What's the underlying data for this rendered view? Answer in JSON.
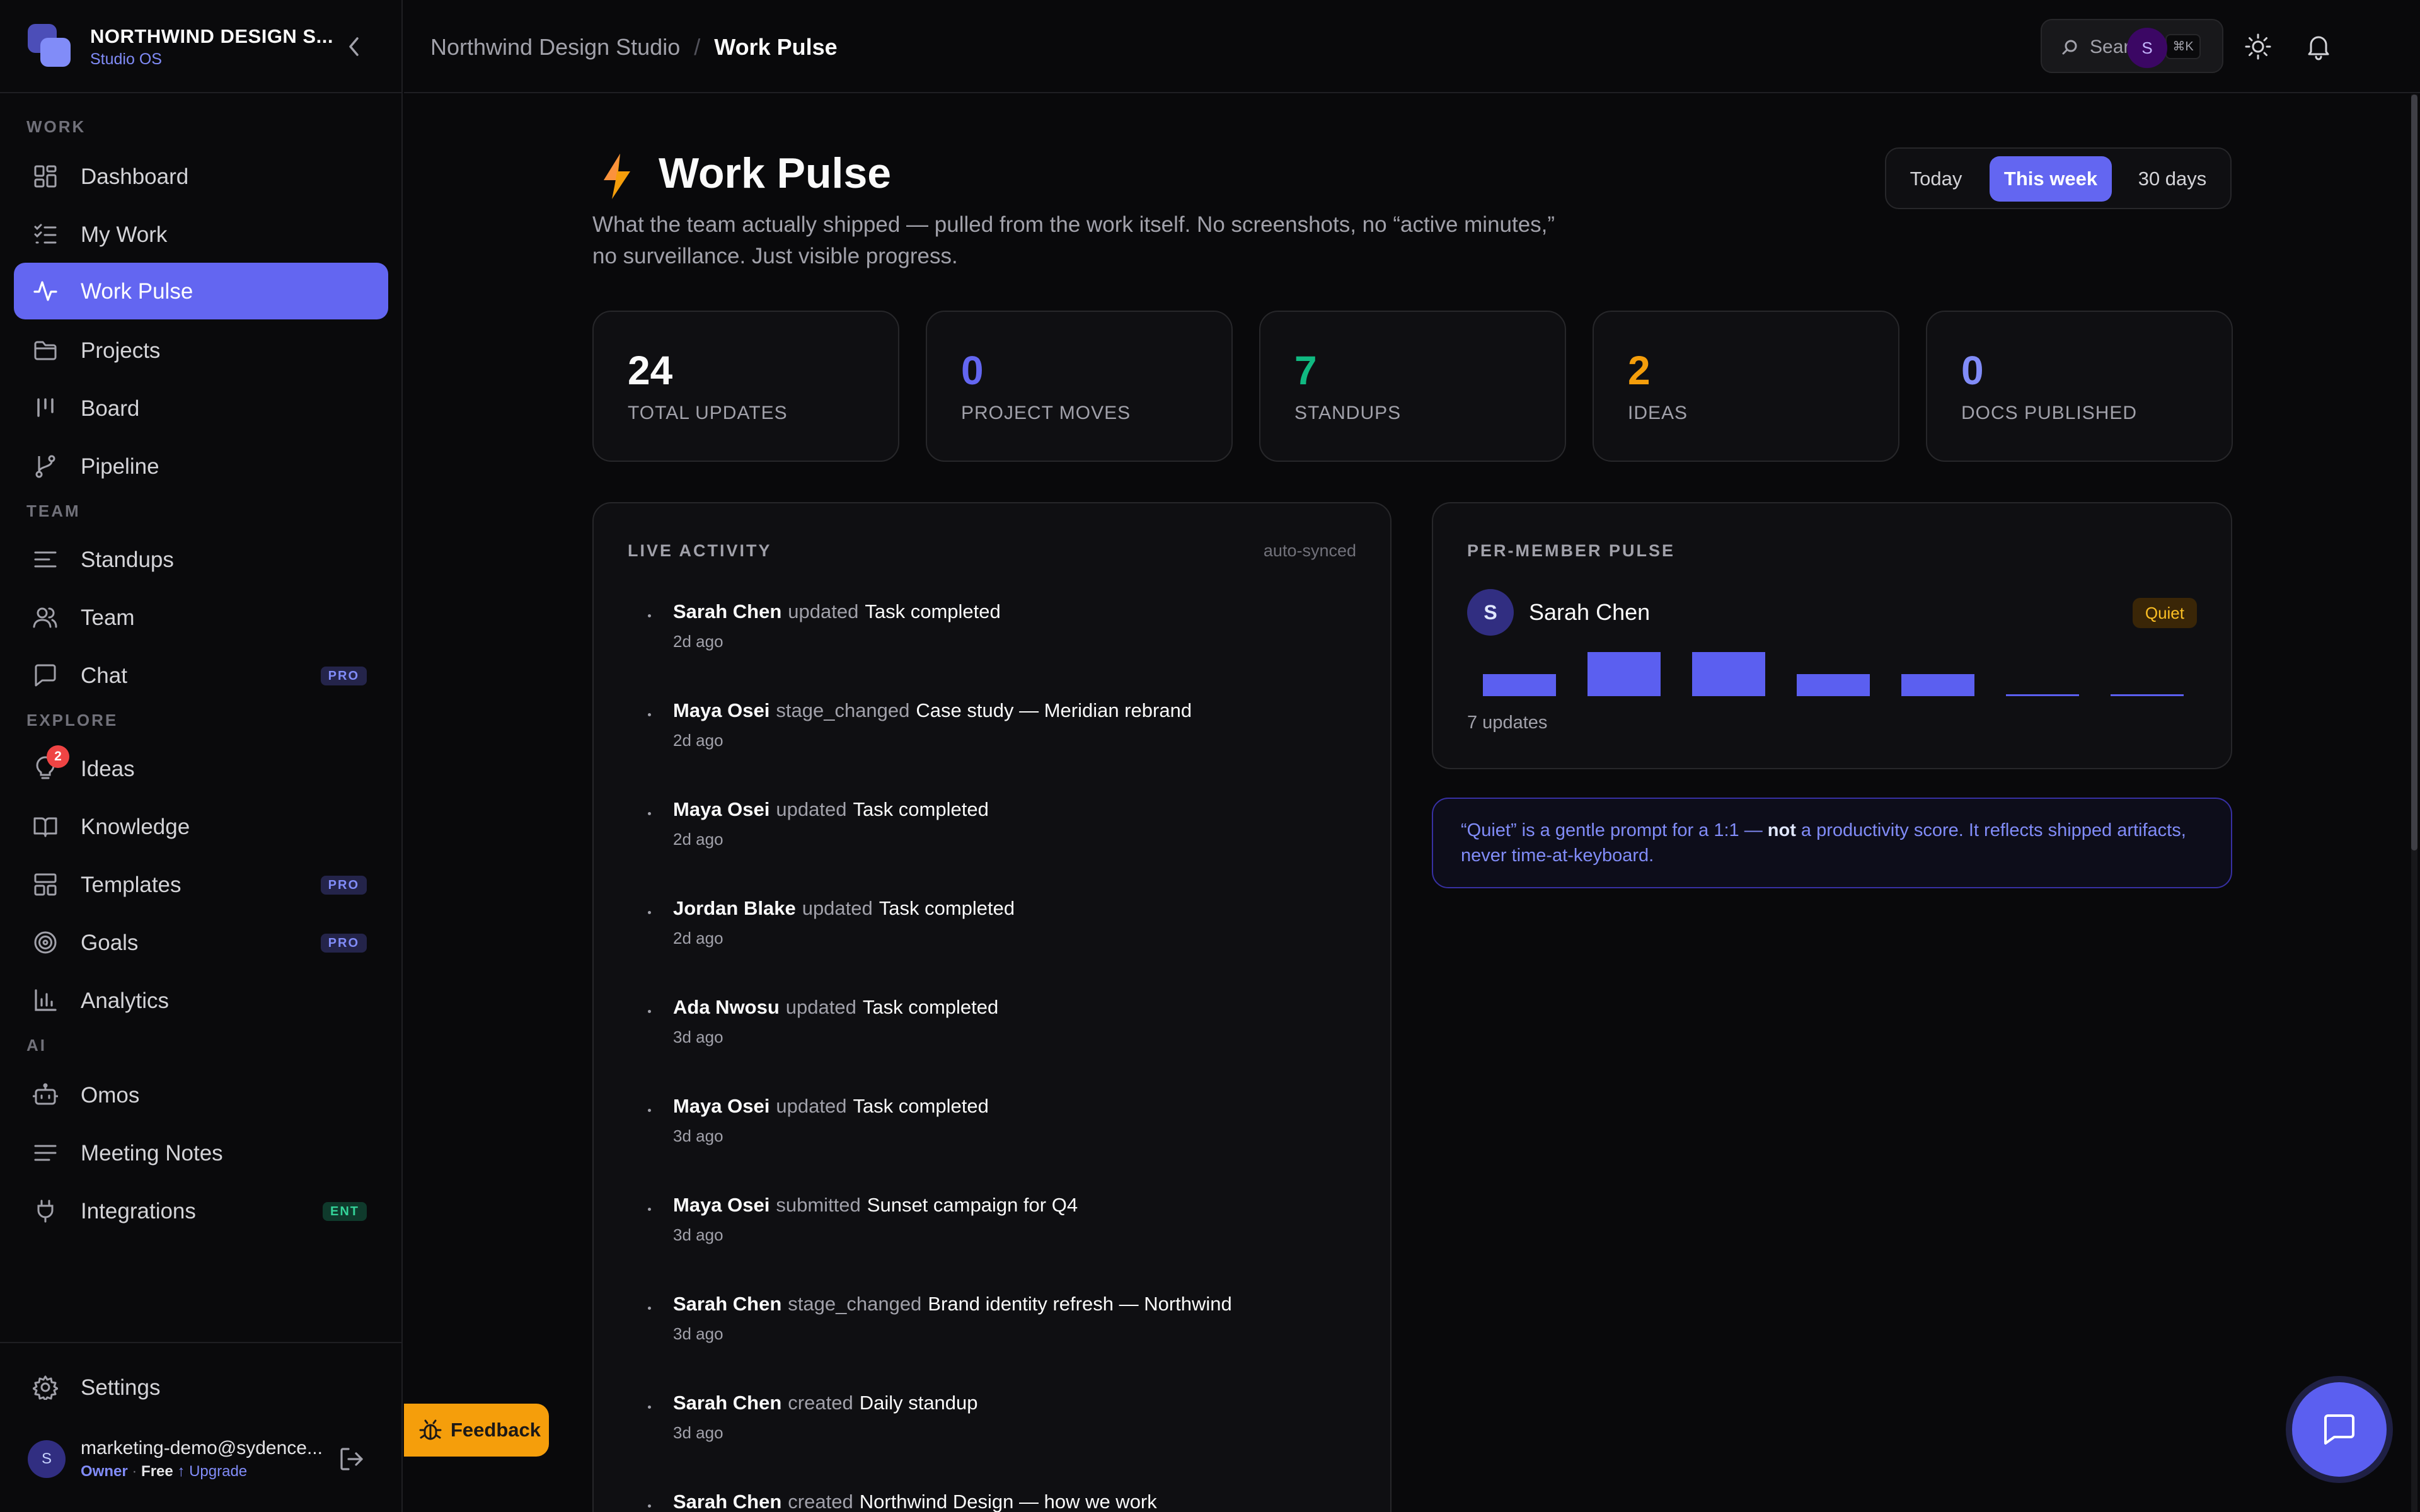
{
  "workspace": {
    "name": "NORTHWIND DESIGN S...",
    "subtitle": "Studio OS"
  },
  "sections": {
    "work": "WORK",
    "team": "TEAM",
    "explore": "EXPLORE",
    "ai": "AI"
  },
  "nav": {
    "dashboard": "Dashboard",
    "my_work": "My Work",
    "work_pulse": "Work Pulse",
    "projects": "Projects",
    "board": "Board",
    "pipeline": "Pipeline",
    "standups": "Standups",
    "team": "Team",
    "chat": "Chat",
    "ideas": "Ideas",
    "ideas_count": "2",
    "knowledge": "Knowledge",
    "templates": "Templates",
    "goals": "Goals",
    "analytics": "Analytics",
    "omos": "Omos",
    "meeting_notes": "Meeting Notes",
    "integrations": "Integrations",
    "settings": "Settings"
  },
  "badges": {
    "pro": "PRO",
    "ent": "ENT"
  },
  "user": {
    "email": "marketing-demo@sydence...",
    "role": "Owner",
    "dot": "·",
    "plan": "Free",
    "upgrade": "↑ Upgrade",
    "initial": "S"
  },
  "breadcrumb": {
    "workspace": "Northwind Design Studio",
    "separator": "/",
    "page": "Work Pulse"
  },
  "search": {
    "label": "Search",
    "shortcut": "⌘K"
  },
  "header_avatar": "S",
  "page": {
    "title": "Work Pulse",
    "description": "What the team actually shipped — pulled from the work itself. No screenshots, no “active minutes,” no surveillance. Just visible progress."
  },
  "range": {
    "today": "Today",
    "week": "This week",
    "thirty": "30 days",
    "selected": "This week"
  },
  "stats": [
    {
      "value": "24",
      "label": "TOTAL UPDATES",
      "color": "#fafafa"
    },
    {
      "value": "0",
      "label": "PROJECT MOVES",
      "color": "#6366f1"
    },
    {
      "value": "7",
      "label": "STANDUPS",
      "color": "#10b981"
    },
    {
      "value": "2",
      "label": "IDEAS",
      "color": "#f59e0b"
    },
    {
      "value": "0",
      "label": "DOCS PUBLISHED",
      "color": "#818cf8"
    }
  ],
  "live_activity": {
    "title": "LIVE ACTIVITY",
    "status": "auto-synced",
    "items": [
      {
        "who": "Sarah Chen",
        "verb": "updated",
        "what": "Task completed",
        "when": "2d ago"
      },
      {
        "who": "Maya Osei",
        "verb": "stage_changed",
        "what": "Case study — Meridian rebrand",
        "when": "2d ago"
      },
      {
        "who": "Maya Osei",
        "verb": "updated",
        "what": "Task completed",
        "when": "2d ago"
      },
      {
        "who": "Jordan Blake",
        "verb": "updated",
        "what": "Task completed",
        "when": "2d ago"
      },
      {
        "who": "Ada Nwosu",
        "verb": "updated",
        "what": "Task completed",
        "when": "3d ago"
      },
      {
        "who": "Maya Osei",
        "verb": "updated",
        "what": "Task completed",
        "when": "3d ago"
      },
      {
        "who": "Maya Osei",
        "verb": "submitted",
        "what": "Sunset campaign for Q4",
        "when": "3d ago"
      },
      {
        "who": "Sarah Chen",
        "verb": "stage_changed",
        "what": "Brand identity refresh — Northwind",
        "when": "3d ago"
      },
      {
        "who": "Sarah Chen",
        "verb": "created",
        "what": "Daily standup",
        "when": "3d ago"
      },
      {
        "who": "Sarah Chen",
        "verb": "created",
        "what": "Northwind Design — how we work",
        "when": ""
      }
    ]
  },
  "member_pulse": {
    "title": "PER-MEMBER PULSE",
    "members": [
      {
        "initial": "S",
        "name": "Sarah Chen",
        "status": "Quiet",
        "count_label": "7 updates",
        "daily": [
          1,
          2,
          2,
          1,
          1,
          0,
          0
        ]
      }
    ]
  },
  "note": {
    "before": "“Quiet” is a gentle prompt for a 1:1 — ",
    "bold": "not",
    "after": " a productivity score. It reflects shipped artifacts, never time-at-keyboard."
  },
  "feedback": "Feedback",
  "colors": {
    "accent": "#6366f1",
    "quiet": "#f59e0b",
    "bar": "#5b5ff0"
  },
  "icons": [
    "lightning-icon",
    "search-icon",
    "sun-icon",
    "bell-icon",
    "chat-bubble-icon",
    "bug-icon",
    "logout-icon",
    "gear-icon"
  ]
}
